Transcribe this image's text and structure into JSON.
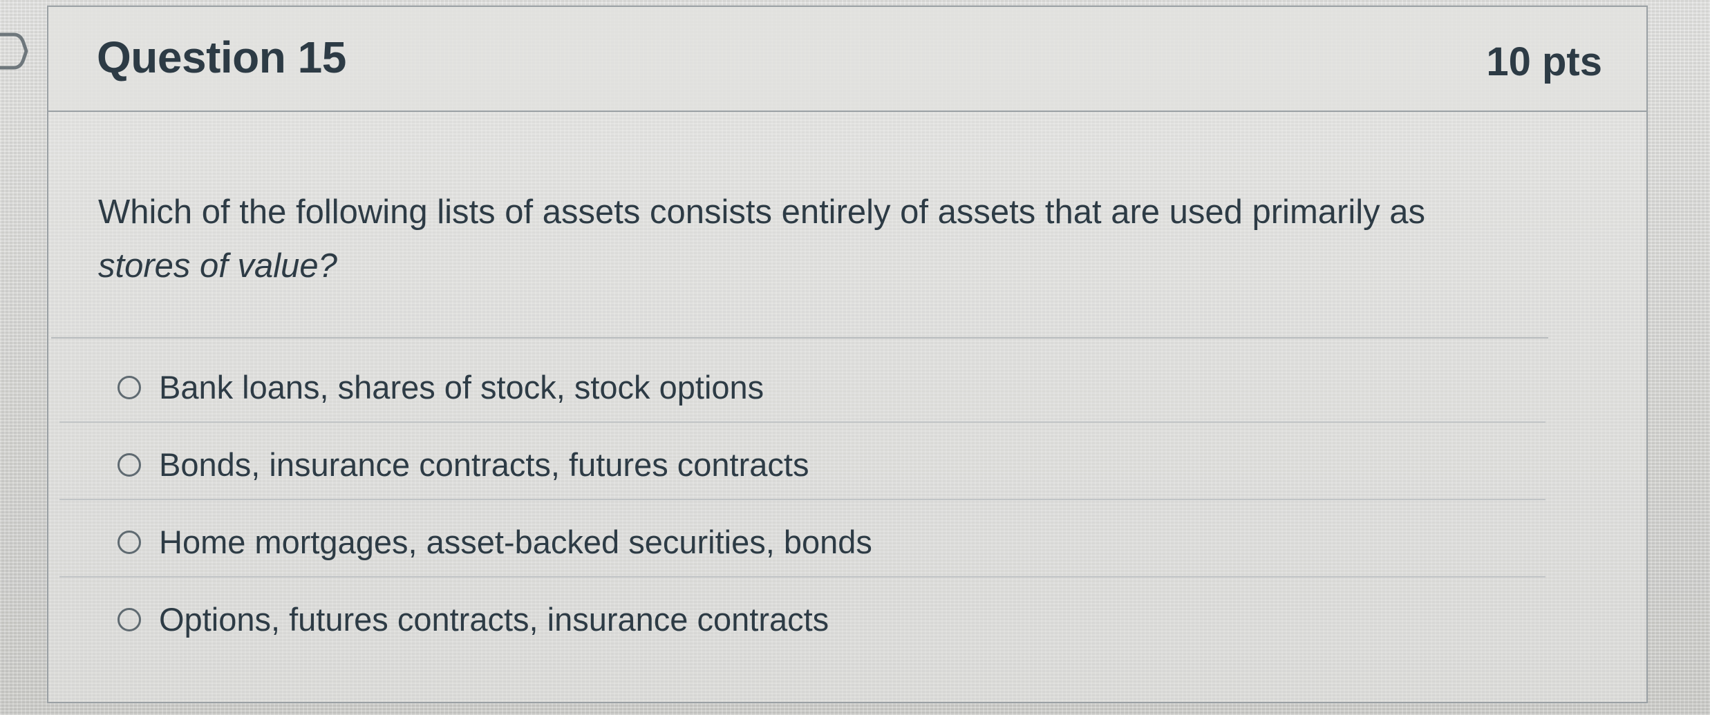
{
  "question": {
    "title": "Question 15",
    "points": "10 pts",
    "text_main": "Which of the following lists of assets consists entirely of assets that are used primarily as",
    "text_emphasis": "stores of value?",
    "answers": [
      {
        "label": "Bank loans, shares of stock, stock options"
      },
      {
        "label": "Bonds, insurance contracts, futures contracts"
      },
      {
        "label": "Home mortgages, asset-backed securities, bonds"
      },
      {
        "label": "Options, futures contracts, insurance contracts"
      }
    ]
  },
  "colors": {
    "text": "#2d3b45",
    "border": "#9aa0a4",
    "background": "#d6d6d3"
  },
  "icons": {
    "previous": "chevron-right-icon",
    "radio": "radio-unchecked-icon"
  }
}
